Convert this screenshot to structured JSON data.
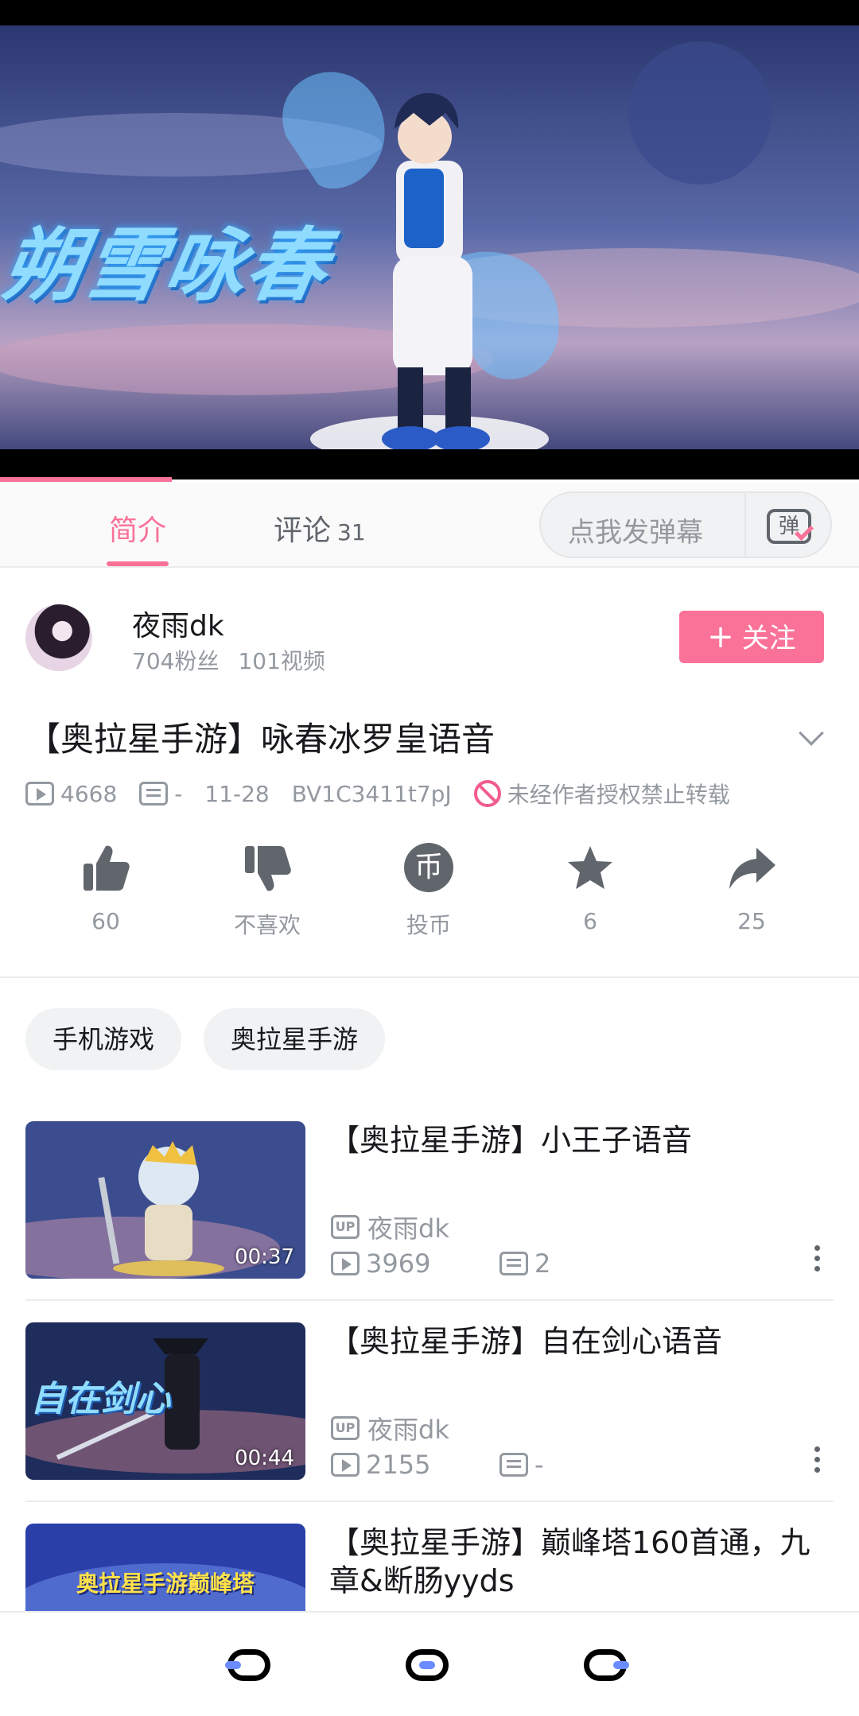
{
  "video": {
    "overlay_title": "朔雪咏春",
    "progress_fraction": 0.2
  },
  "tabs": {
    "intro": "简介",
    "comments": "评论",
    "comments_count": "31",
    "danmaku_placeholder": "点我发弹幕",
    "danmaku_icon": "弹"
  },
  "author": {
    "name": "夜雨dk",
    "fans": "704粉丝",
    "videos": "101视频",
    "follow_label": "关注"
  },
  "title": "【奥拉星手游】咏春冰罗皇语音",
  "meta": {
    "views": "4668",
    "danmaku": "-",
    "date": "11-28",
    "bvid": "BV1C3411t7pJ",
    "notice": "未经作者授权禁止转载"
  },
  "actions": {
    "like": "60",
    "dislike": "不喜欢",
    "coin": "投币",
    "coin_icon": "币",
    "favorite": "6",
    "share": "25"
  },
  "tags": [
    "手机游戏",
    "奥拉星手游"
  ],
  "recommendations": [
    {
      "title": "【奥拉星手游】小王子语音",
      "up": "夜雨dk",
      "views": "3969",
      "danmaku": "2",
      "duration": "00:37"
    },
    {
      "title": "【奥拉星手游】自在剑心语音",
      "up": "夜雨dk",
      "views": "2155",
      "danmaku": "-",
      "duration": "00:44",
      "thumb_text": "自在剑心"
    },
    {
      "title": "【奥拉星手游】巅峰塔160首通，九章&断肠yyds",
      "thumb_text": "奥拉星手游巅峰塔"
    }
  ],
  "up_badge": "UP",
  "colors": {
    "accent": "#fb7299",
    "text_secondary": "#9499a0",
    "nav_dot": "#6a8cff"
  }
}
